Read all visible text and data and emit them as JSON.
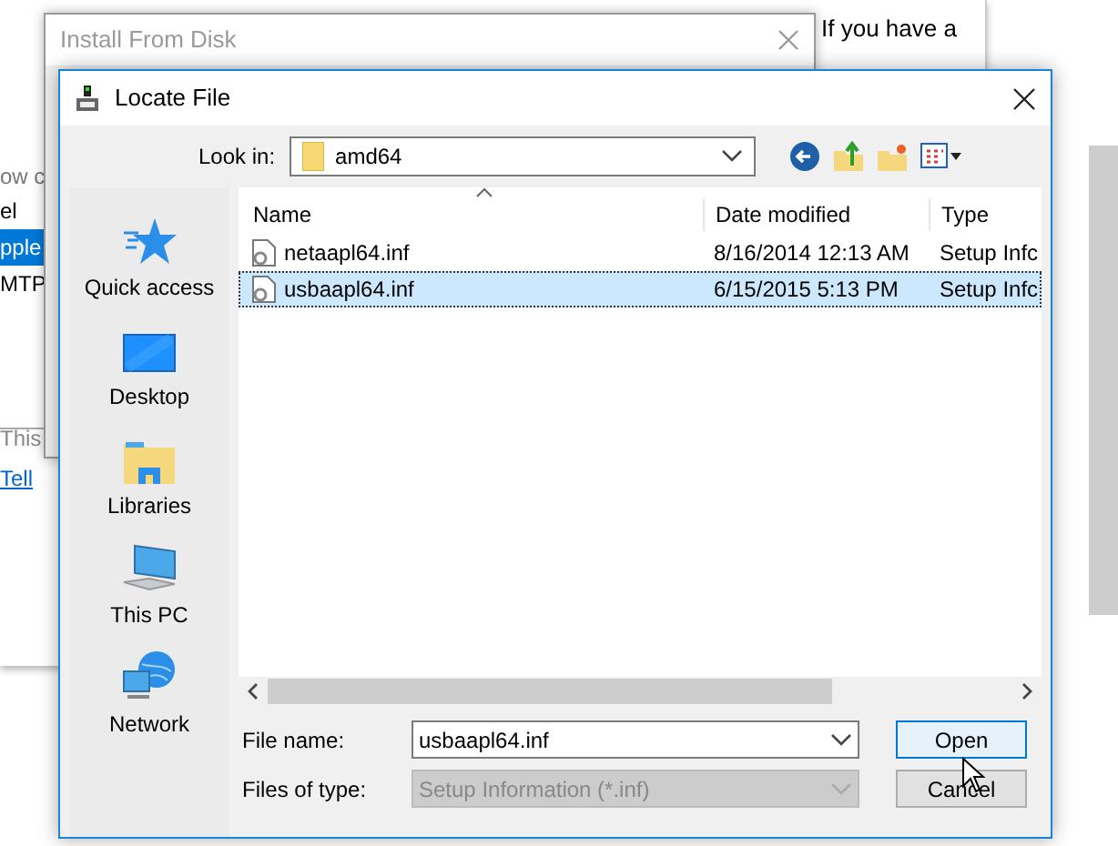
{
  "background_window": {
    "fragments": [
      "If you have a"
    ],
    "prompt": "ow c",
    "list": [
      {
        "label": "el",
        "selected": false
      },
      {
        "label": "pple",
        "selected": true
      },
      {
        "label": "MTP",
        "selected": false
      }
    ],
    "note": "This",
    "link": "Tell"
  },
  "install_dialog": {
    "title": "Install From Disk"
  },
  "locate_dialog": {
    "title": "Locate File",
    "look_in": {
      "label": "Look in:",
      "value": "amd64"
    },
    "places": [
      {
        "kind": "quick",
        "label": "Quick access"
      },
      {
        "kind": "desktop",
        "label": "Desktop"
      },
      {
        "kind": "libraries",
        "label": "Libraries"
      },
      {
        "kind": "pc",
        "label": "This PC"
      },
      {
        "kind": "network",
        "label": "Network"
      }
    ],
    "columns": [
      "Name",
      "Date modified",
      "Type"
    ],
    "rows": [
      {
        "name": "netaapl64.inf",
        "date": "8/16/2014 12:13 AM",
        "type": "Setup Infc",
        "selected": false
      },
      {
        "name": "usbaapl64.inf",
        "date": "6/15/2015 5:13 PM",
        "type": "Setup Infc",
        "selected": true
      }
    ],
    "file_name": {
      "label": "File name:",
      "value": "usbaapl64.inf"
    },
    "file_type": {
      "label": "Files of type:",
      "value": "Setup Information (*.inf)",
      "disabled": true
    },
    "buttons": [
      {
        "label": "Open",
        "default": true
      },
      {
        "label": "Cancel",
        "default": false
      }
    ]
  }
}
